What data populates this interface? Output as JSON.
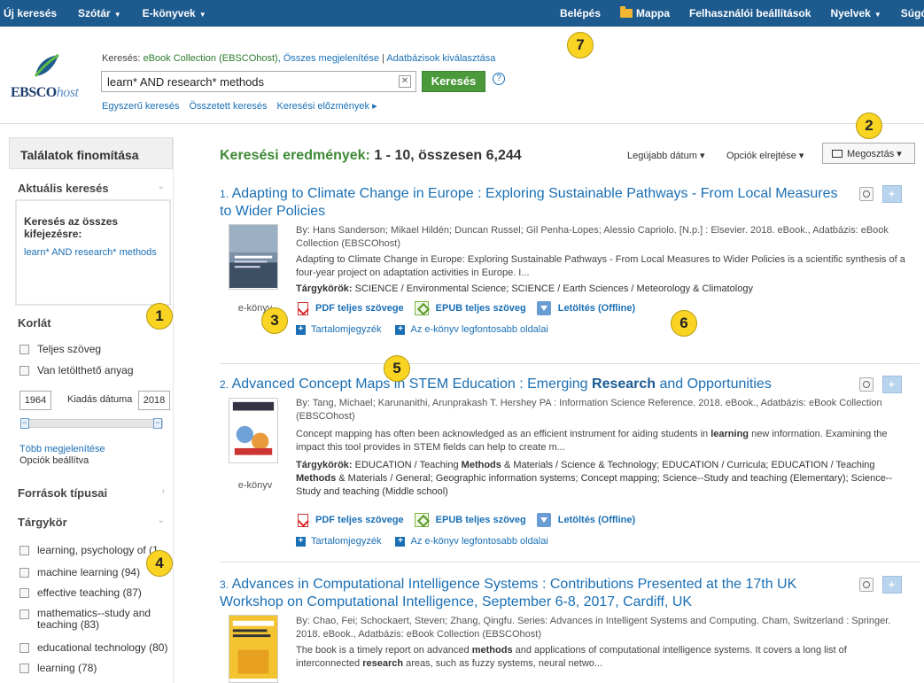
{
  "topnav": {
    "left": [
      {
        "label": "Új keresés",
        "caret": false
      },
      {
        "label": "Szótár",
        "caret": true
      },
      {
        "label": "E-könyvek",
        "caret": true
      }
    ],
    "right": [
      {
        "label": "Belépés",
        "caret": false
      },
      {
        "label": "Mappa",
        "caret": false
      },
      {
        "label": "Felhasználói beállítások",
        "caret": false
      },
      {
        "label": "Nyelvek",
        "caret": true
      },
      {
        "label": "Súgó",
        "caret": false
      }
    ]
  },
  "header": {
    "logo_main": "EBSCO",
    "logo_sub": "host",
    "crumb_prefix": "Keresés: ",
    "crumb_db": "eBook Collection (EBSCOhost)",
    "crumb_show": ", Összes megjelenítése",
    "crumb_sep": " | ",
    "crumb_select": "Adatbázisok kiválasztása",
    "search_value": "learn* AND research* methods",
    "search_btn": "Keresés",
    "help": "?",
    "sublinks": [
      "Egyszerű keresés",
      "Összetett keresés",
      "Keresési előzmények ▸"
    ]
  },
  "sidebar": {
    "title": "Találatok finomítása",
    "current_search": "Aktuális keresés",
    "current_label": "Keresés az összes kifejezésre:",
    "current_query": "learn* AND research* methods",
    "limit": "Korlát",
    "full_text": "Teljes szöveg",
    "downloadable": "Van letölthető anyag",
    "date_from": "1964",
    "date_label": "Kiadás dátuma",
    "date_to": "2018",
    "show_more": "Több megjelenítése",
    "options_set": "Opciók beállítva",
    "source_types": "Források típusai",
    "subject": "Tárgykör",
    "subjects": [
      "learning, psychology of (1",
      "machine learning (94)",
      "effective teaching (87)",
      "mathematics--study and teaching (83)",
      "educational technology (80)",
      "learning (78)"
    ]
  },
  "results": {
    "title_prefix": "Keresési eredmények: ",
    "title_count": "1 - 10, összesen 6,244",
    "sort": "Legújabb dátum ▾",
    "options": "Opciók elrejtése ▾",
    "share": "Megosztás ▾",
    "records": [
      {
        "num": "1.",
        "title": "Adapting to Climate Change in Europe : Exploring Sustainable Pathways - From Local Measures to Wider Policies",
        "by": "By: Hans Sanderson; Mikael Hildén; Duncan Russel; Gil Penha-Lopes; Alessio Capriolo. [N.p.] : Elsevier. 2018. eBook., Adatbázis: eBook Collection (EBSCOhost)",
        "abstract": "Adapting to Climate Change in Europe: Exploring Sustainable Pathways - From Local Measures to Wider Policies is a scientific synthesis of a four-year project on adaptation activities in Europe. I...",
        "subjects_label": "Tárgykörök:",
        "subjects": " SCIENCE / Environmental Science; SCIENCE / Earth Sciences / Meteorology & Climatology",
        "type": "e-könyv"
      },
      {
        "num": "2.",
        "title_a": "Advanced Concept Maps in STEM Education : Emerging ",
        "title_b": "Research",
        "title_c": " and Opportunities",
        "by": "By: Tang, Michael; Karunanithi, Arunprakash T. Hershey PA : Information Science Reference. 2018. eBook., Adatbázis: eBook Collection (EBSCOhost)",
        "abs_a": "Concept mapping has often been acknowledged as an efficient instrument for aiding students in ",
        "abs_b": "learning",
        "abs_c": " new information. Examining the impact this tool provides in STEM fields can help to create m...",
        "subjects_label": "Tárgykörök:",
        "subj_a": " EDUCATION / Teaching ",
        "subj_b": "Methods",
        "subj_c": " & Materials / Science & Technology; EDUCATION / Curricula; EDUCATION / Teaching ",
        "subj_d": "Methods",
        "subj_e": " & Materials / General; Geographic information systems; Concept mapping; Science--Study and teaching (Elementary); Science--Study and teaching (Middle school)",
        "type": "e-könyv"
      },
      {
        "num": "3.",
        "title": "Advances in Computational Intelligence Systems : Contributions Presented at the 17th UK Workshop on Computational Intelligence, September 6-8, 2017, Cardiff, UK",
        "by": "By: Chao, Fei; Schockaert, Steven; Zhang, Qingfu. Series: Advances in Intelligent Systems and Computing. Cham, Switzerland : Springer. 2018. eBook., Adatbázis: eBook Collection (EBSCOhost)",
        "abs_a": "The book is a timely report on advanced ",
        "abs_b": "methods",
        "abs_c": " and applications of computational intelligence systems. It covers a long list of interconnected ",
        "abs_d": "research",
        "abs_e": " areas, such as fuzzy systems, neural netwo..."
      }
    ],
    "links": {
      "pdf": "PDF teljes szövege",
      "epub": "EPUB teljes szöveg",
      "download": "Letöltés (Offline)",
      "toc": "Tartalomjegyzék",
      "key_pages": "Az e-könyv legfontosabb oldalai"
    }
  },
  "badges": [
    "1",
    "2",
    "3",
    "4",
    "5",
    "6",
    "7"
  ],
  "colors": {
    "nav": "#1d5a8e",
    "accent_green": "#4a9a3c",
    "link": "#1a6fb4",
    "badge": "#f9d423"
  }
}
